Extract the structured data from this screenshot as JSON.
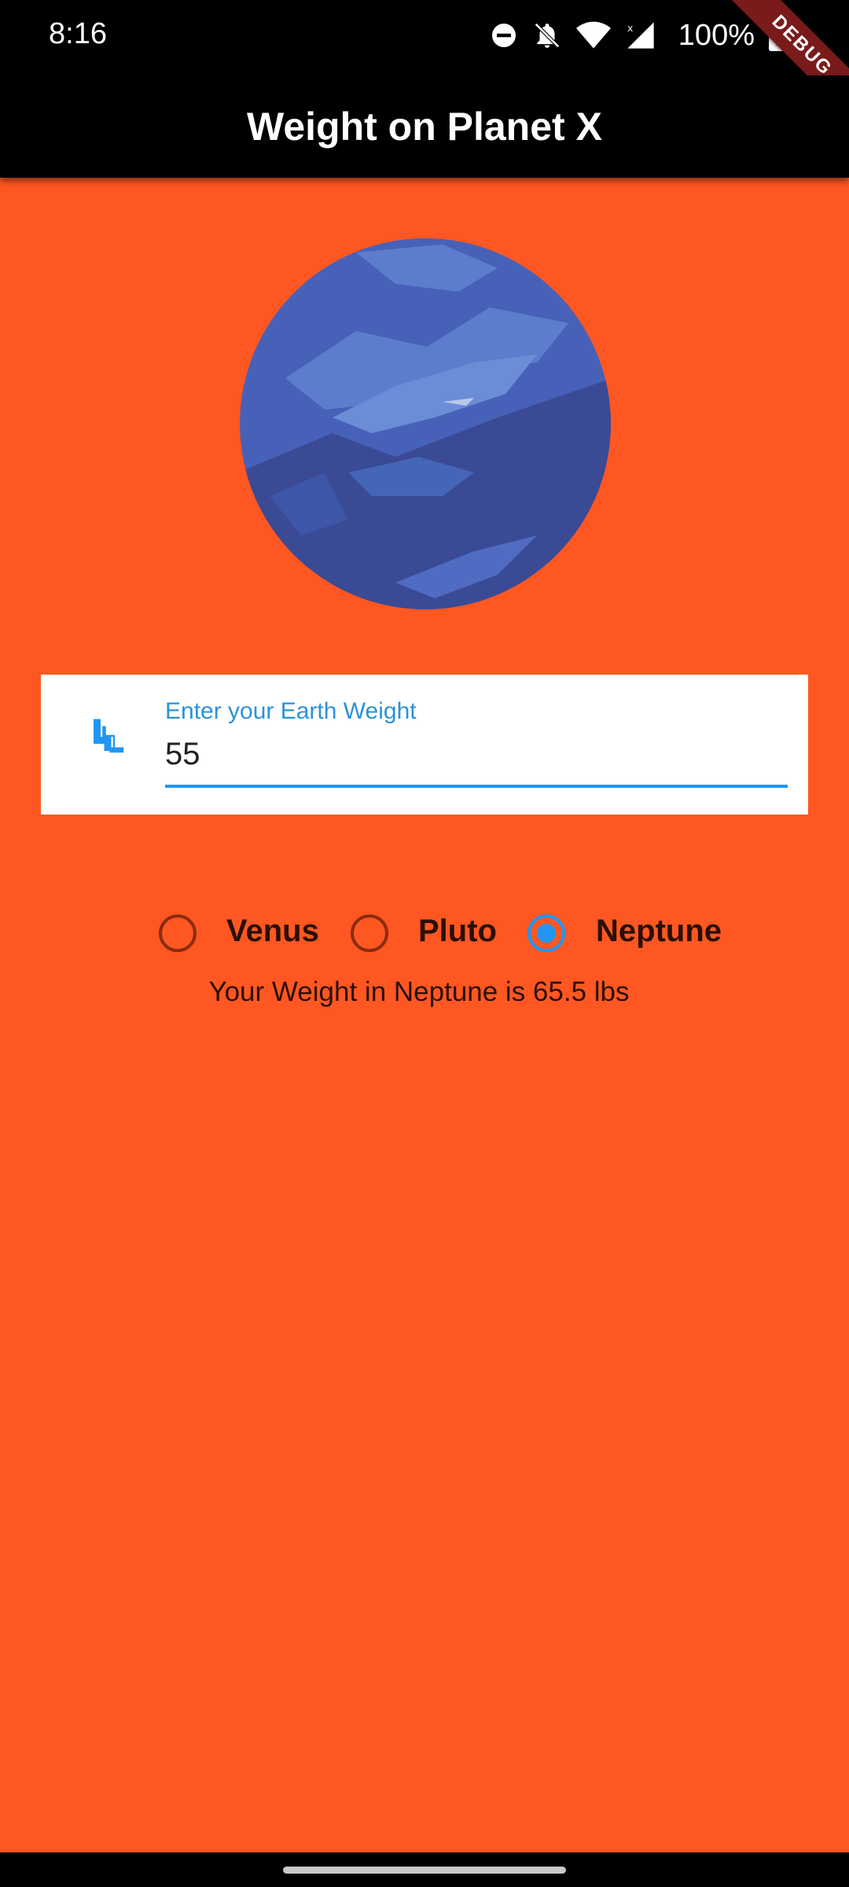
{
  "status_bar": {
    "time": "8:16",
    "battery": "100%",
    "icons": [
      "dnd-icon",
      "bell-off-icon",
      "wifi-icon",
      "signal-icon",
      "battery-charging-icon"
    ]
  },
  "debug_banner": "DEBUG",
  "app_bar": {
    "title": "Weight on Planet X"
  },
  "planet_image": {
    "icon": "neptune-planet-image"
  },
  "weight_input": {
    "label": "Enter your Earth Weight",
    "value": "55",
    "icon": "weight-scale-icon"
  },
  "planets": [
    {
      "label": "Venus",
      "selected": false
    },
    {
      "label": "Pluto",
      "selected": false
    },
    {
      "label": "Neptune",
      "selected": true
    }
  ],
  "result": "Your Weight in Neptune is 65.5 lbs",
  "colors": {
    "background": "#ff5722",
    "accent": "#2196f3",
    "app_bar": "#000000"
  }
}
